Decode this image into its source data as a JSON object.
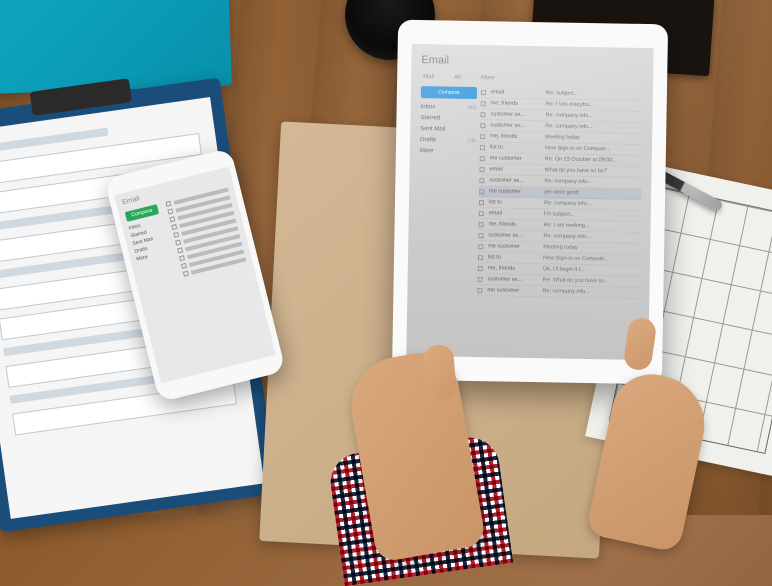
{
  "scene": {
    "description": "Overhead photo of hands holding a white tablet showing an email client, on a wooden desk with a phone, clipboard form, manila folder, coffee cup, pen, and blueprint"
  },
  "tablet": {
    "app_title": "Email",
    "header": {
      "view_label": "Mail",
      "filter_label": "All",
      "more_label": "More"
    },
    "compose_label": "Compose",
    "folders": [
      {
        "name": "Inbox",
        "count": "(40)"
      },
      {
        "name": "Starred",
        "count": ""
      },
      {
        "name": "Sent Mail",
        "count": ""
      },
      {
        "name": "Drafts",
        "count": "(16)"
      },
      {
        "name": "More",
        "count": ""
      }
    ],
    "messages": [
      {
        "from": "email",
        "subject": "Re: subject..."
      },
      {
        "from": "me, friends",
        "subject": "Re: I see everybo..."
      },
      {
        "from": "customer se...",
        "subject": "Re: company info..."
      },
      {
        "from": "customer se...",
        "subject": "Re: company info..."
      },
      {
        "from": "me, friends",
        "subject": "Meeting today"
      },
      {
        "from": "list to",
        "subject": "New Sign-in on Compute..."
      },
      {
        "from": "me customer",
        "subject": "Re: On 23 October at 09:00..."
      },
      {
        "from": "email",
        "subject": "What do you have so far?"
      },
      {
        "from": "customer se...",
        "subject": "Re: company info..."
      },
      {
        "from": "me customer",
        "subject": "yet were good"
      },
      {
        "from": "list to",
        "subject": "Re: company info..."
      },
      {
        "from": "email",
        "subject": "I'm subject..."
      },
      {
        "from": "me, friends",
        "subject": "Re: I am working..."
      },
      {
        "from": "customer se...",
        "subject": "Re: company info..."
      },
      {
        "from": "me customer",
        "subject": "Meeting today"
      },
      {
        "from": "list to",
        "subject": "New Sign-in on Compute..."
      },
      {
        "from": "me, friends",
        "subject": "Ok, I'll begin it t..."
      },
      {
        "from": "customer se...",
        "subject": "Re: What do you have so..."
      },
      {
        "from": "me customer",
        "subject": "Re: company info..."
      }
    ]
  },
  "phone": {
    "app_title": "Email",
    "compose_label": "Compose",
    "folders": [
      {
        "name": "Inbox"
      },
      {
        "name": "Starred"
      },
      {
        "name": "Sent Mail"
      },
      {
        "name": "Drafts"
      },
      {
        "name": "More"
      }
    ]
  }
}
